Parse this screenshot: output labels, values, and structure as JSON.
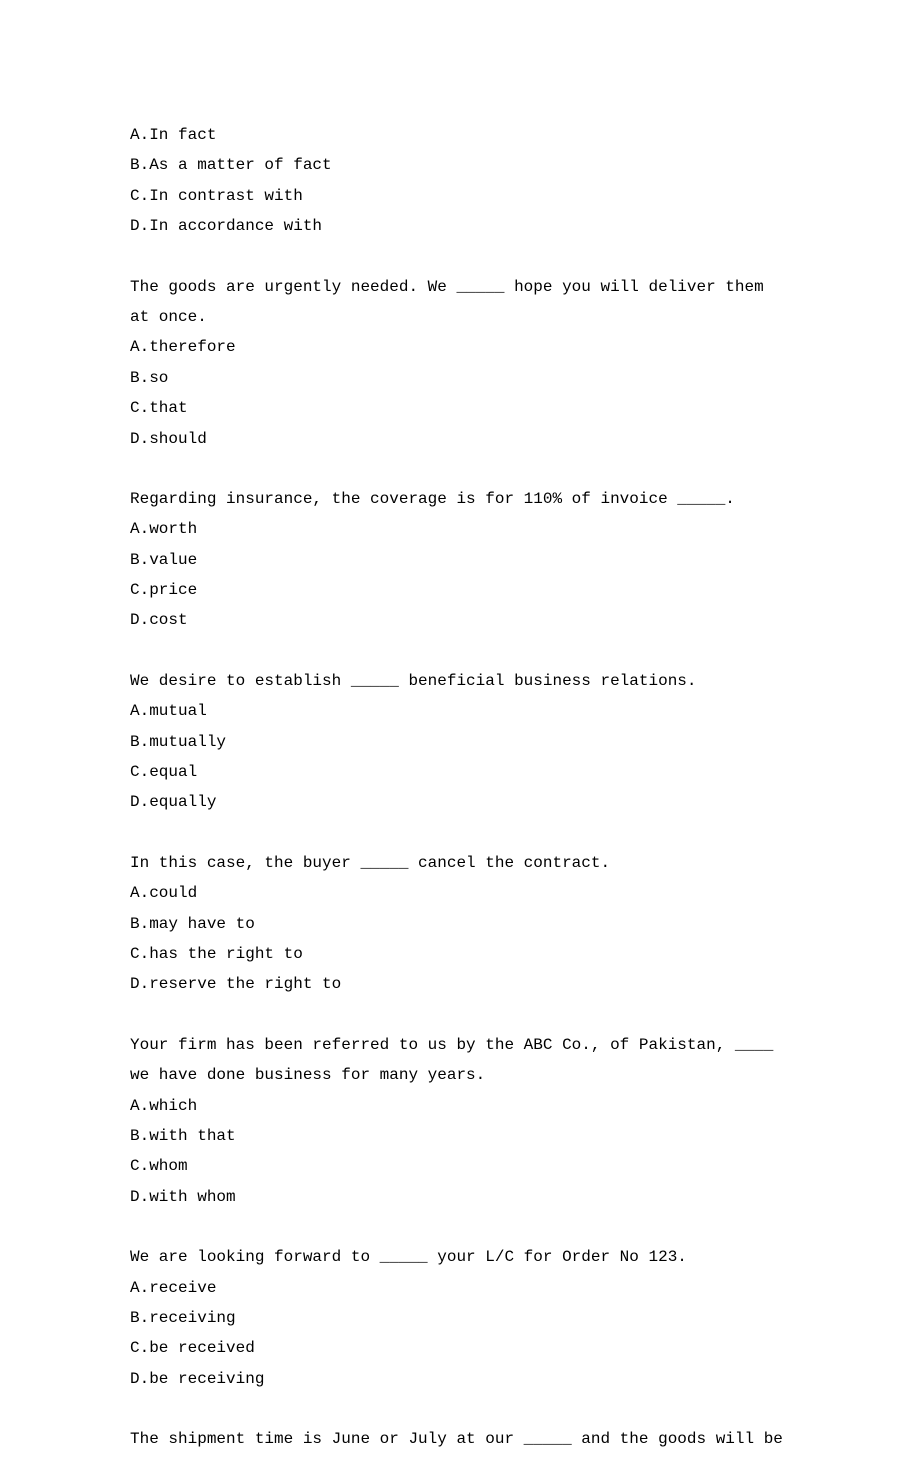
{
  "questions": [
    {
      "stem": "",
      "options": [
        "A.In fact",
        "B.As a matter of fact",
        "C.In contrast with",
        "D.In accordance with"
      ]
    },
    {
      "stem": "The goods are urgently needed. We _____ hope you will deliver them at once.",
      "options": [
        "A.therefore",
        "B.so",
        "C.that",
        "D.should"
      ]
    },
    {
      "stem": "Regarding insurance, the coverage is for 110% of invoice _____.",
      "options": [
        "A.worth",
        "B.value",
        "C.price",
        "D.cost"
      ]
    },
    {
      "stem": "We desire to establish _____ beneficial business relations.",
      "options": [
        "A.mutual",
        "B.mutually",
        "C.equal",
        "D.equally"
      ]
    },
    {
      "stem": "In this case, the buyer _____ cancel the contract.",
      "options": [
        "A.could",
        "B.may have to",
        "C.has the right to",
        "D.reserve the right to"
      ]
    },
    {
      "stem": "Your firm has been referred to us by the ABC Co., of Pakistan, ____ we have done business for many years.",
      "options": [
        "A.which",
        "B.with that",
        "C.whom",
        "D.with whom"
      ]
    },
    {
      "stem": "We are looking forward to _____ your L/C for Order No 123.",
      "options": [
        "A.receive",
        "B.receiving",
        "C.be received",
        "D.be receiving"
      ]
    },
    {
      "stem": "The shipment time is June or July at our _____ and the goods will be",
      "options": []
    }
  ]
}
